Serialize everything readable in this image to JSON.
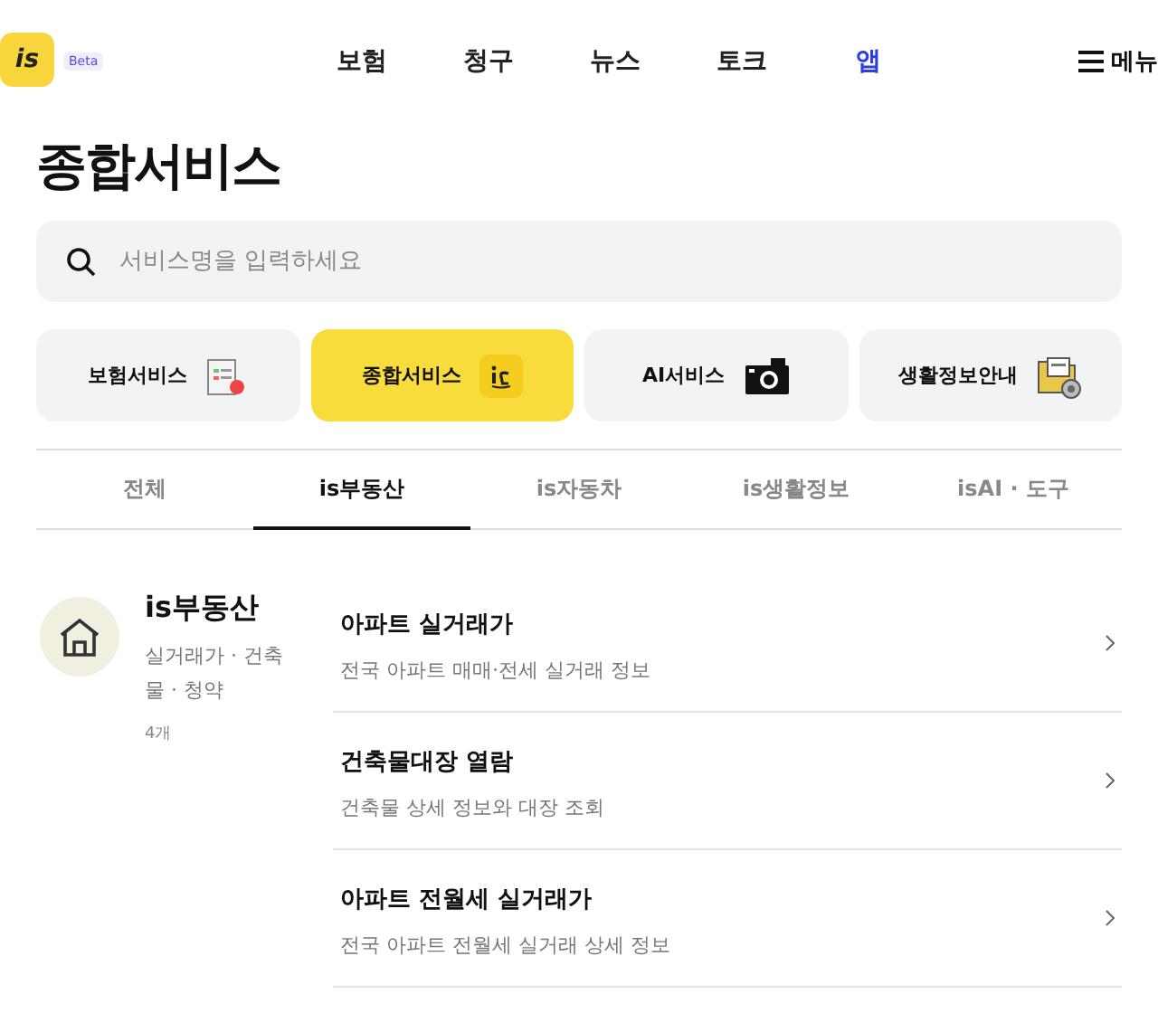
{
  "header": {
    "logo": "is",
    "badge": "Beta",
    "nav": [
      {
        "label": "보험",
        "selected": false
      },
      {
        "label": "청구",
        "selected": false
      },
      {
        "label": "뉴스",
        "selected": false
      },
      {
        "label": "토크",
        "selected": false
      },
      {
        "label": "앱",
        "selected": true
      }
    ],
    "menu": "메뉴"
  },
  "title": "종합서비스",
  "search": {
    "placeholder": "서비스명을 입력하세요"
  },
  "categories": [
    {
      "label": "보험서비스",
      "kind": "document",
      "selected": false
    },
    {
      "label": "종합서비스",
      "kind": "logo",
      "selected": true
    },
    {
      "label": "AI서비스",
      "kind": "camera",
      "selected": false
    },
    {
      "label": "생활정보안내",
      "kind": "folder",
      "selected": false
    }
  ],
  "tabs": [
    {
      "label": "전체",
      "selected": false
    },
    {
      "label": "is부동산",
      "selected": true
    },
    {
      "label": "is자동차",
      "selected": false
    },
    {
      "label": "is생활정보",
      "selected": false
    },
    {
      "label": "isAI · 도구",
      "selected": false
    }
  ],
  "section": {
    "title": "is부동산",
    "description": "실거래가 · 건축물 · 청약",
    "count": "4개",
    "items": [
      {
        "title": "아파트 실거래가",
        "subtitle": "전국 아파트 매매·전세 실거래 정보"
      },
      {
        "title": "건축물대장 열람",
        "subtitle": "건축물 상세 정보와 대장 조회"
      },
      {
        "title": "아파트 전월세 실거래가",
        "subtitle": "전국 아파트 전월세 실거래 상세 정보"
      }
    ]
  }
}
